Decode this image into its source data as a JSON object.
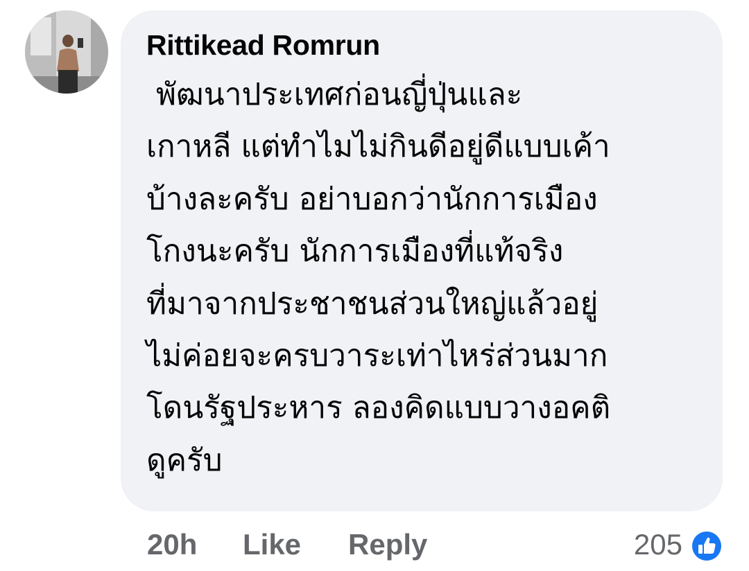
{
  "comment": {
    "author": "Rittikead Romrun",
    "lines": [
      " พัฒนาประเทศก่อนญี่ปุ่นและ",
      "เกาหลี แต่ทำไมไม่กินดีอยู่ดีแบบเค้า",
      "บ้างละครับ อย่าบอกว่านักการเมือง",
      "โกงนะครับ นักการเมืองที่แท้จริง",
      "ที่มาจากประชาชนส่วนใหญ่แล้วอยู่",
      "ไม่ค่อยจะครบวาระเท่าไหร่ส่วนมาก",
      "โดนรัฐประหาร ลองคิดแบบวางอคติ",
      "ดูครับ"
    ]
  },
  "actions": {
    "timestamp": "20h",
    "like_label": "Like",
    "reply_label": "Reply"
  },
  "reactions": {
    "count": "205",
    "icon": "thumbs-up-icon",
    "color": "#1877f2"
  },
  "colors": {
    "bubble": "#f0f2f5",
    "text": "#050505",
    "secondary": "#65676b"
  }
}
